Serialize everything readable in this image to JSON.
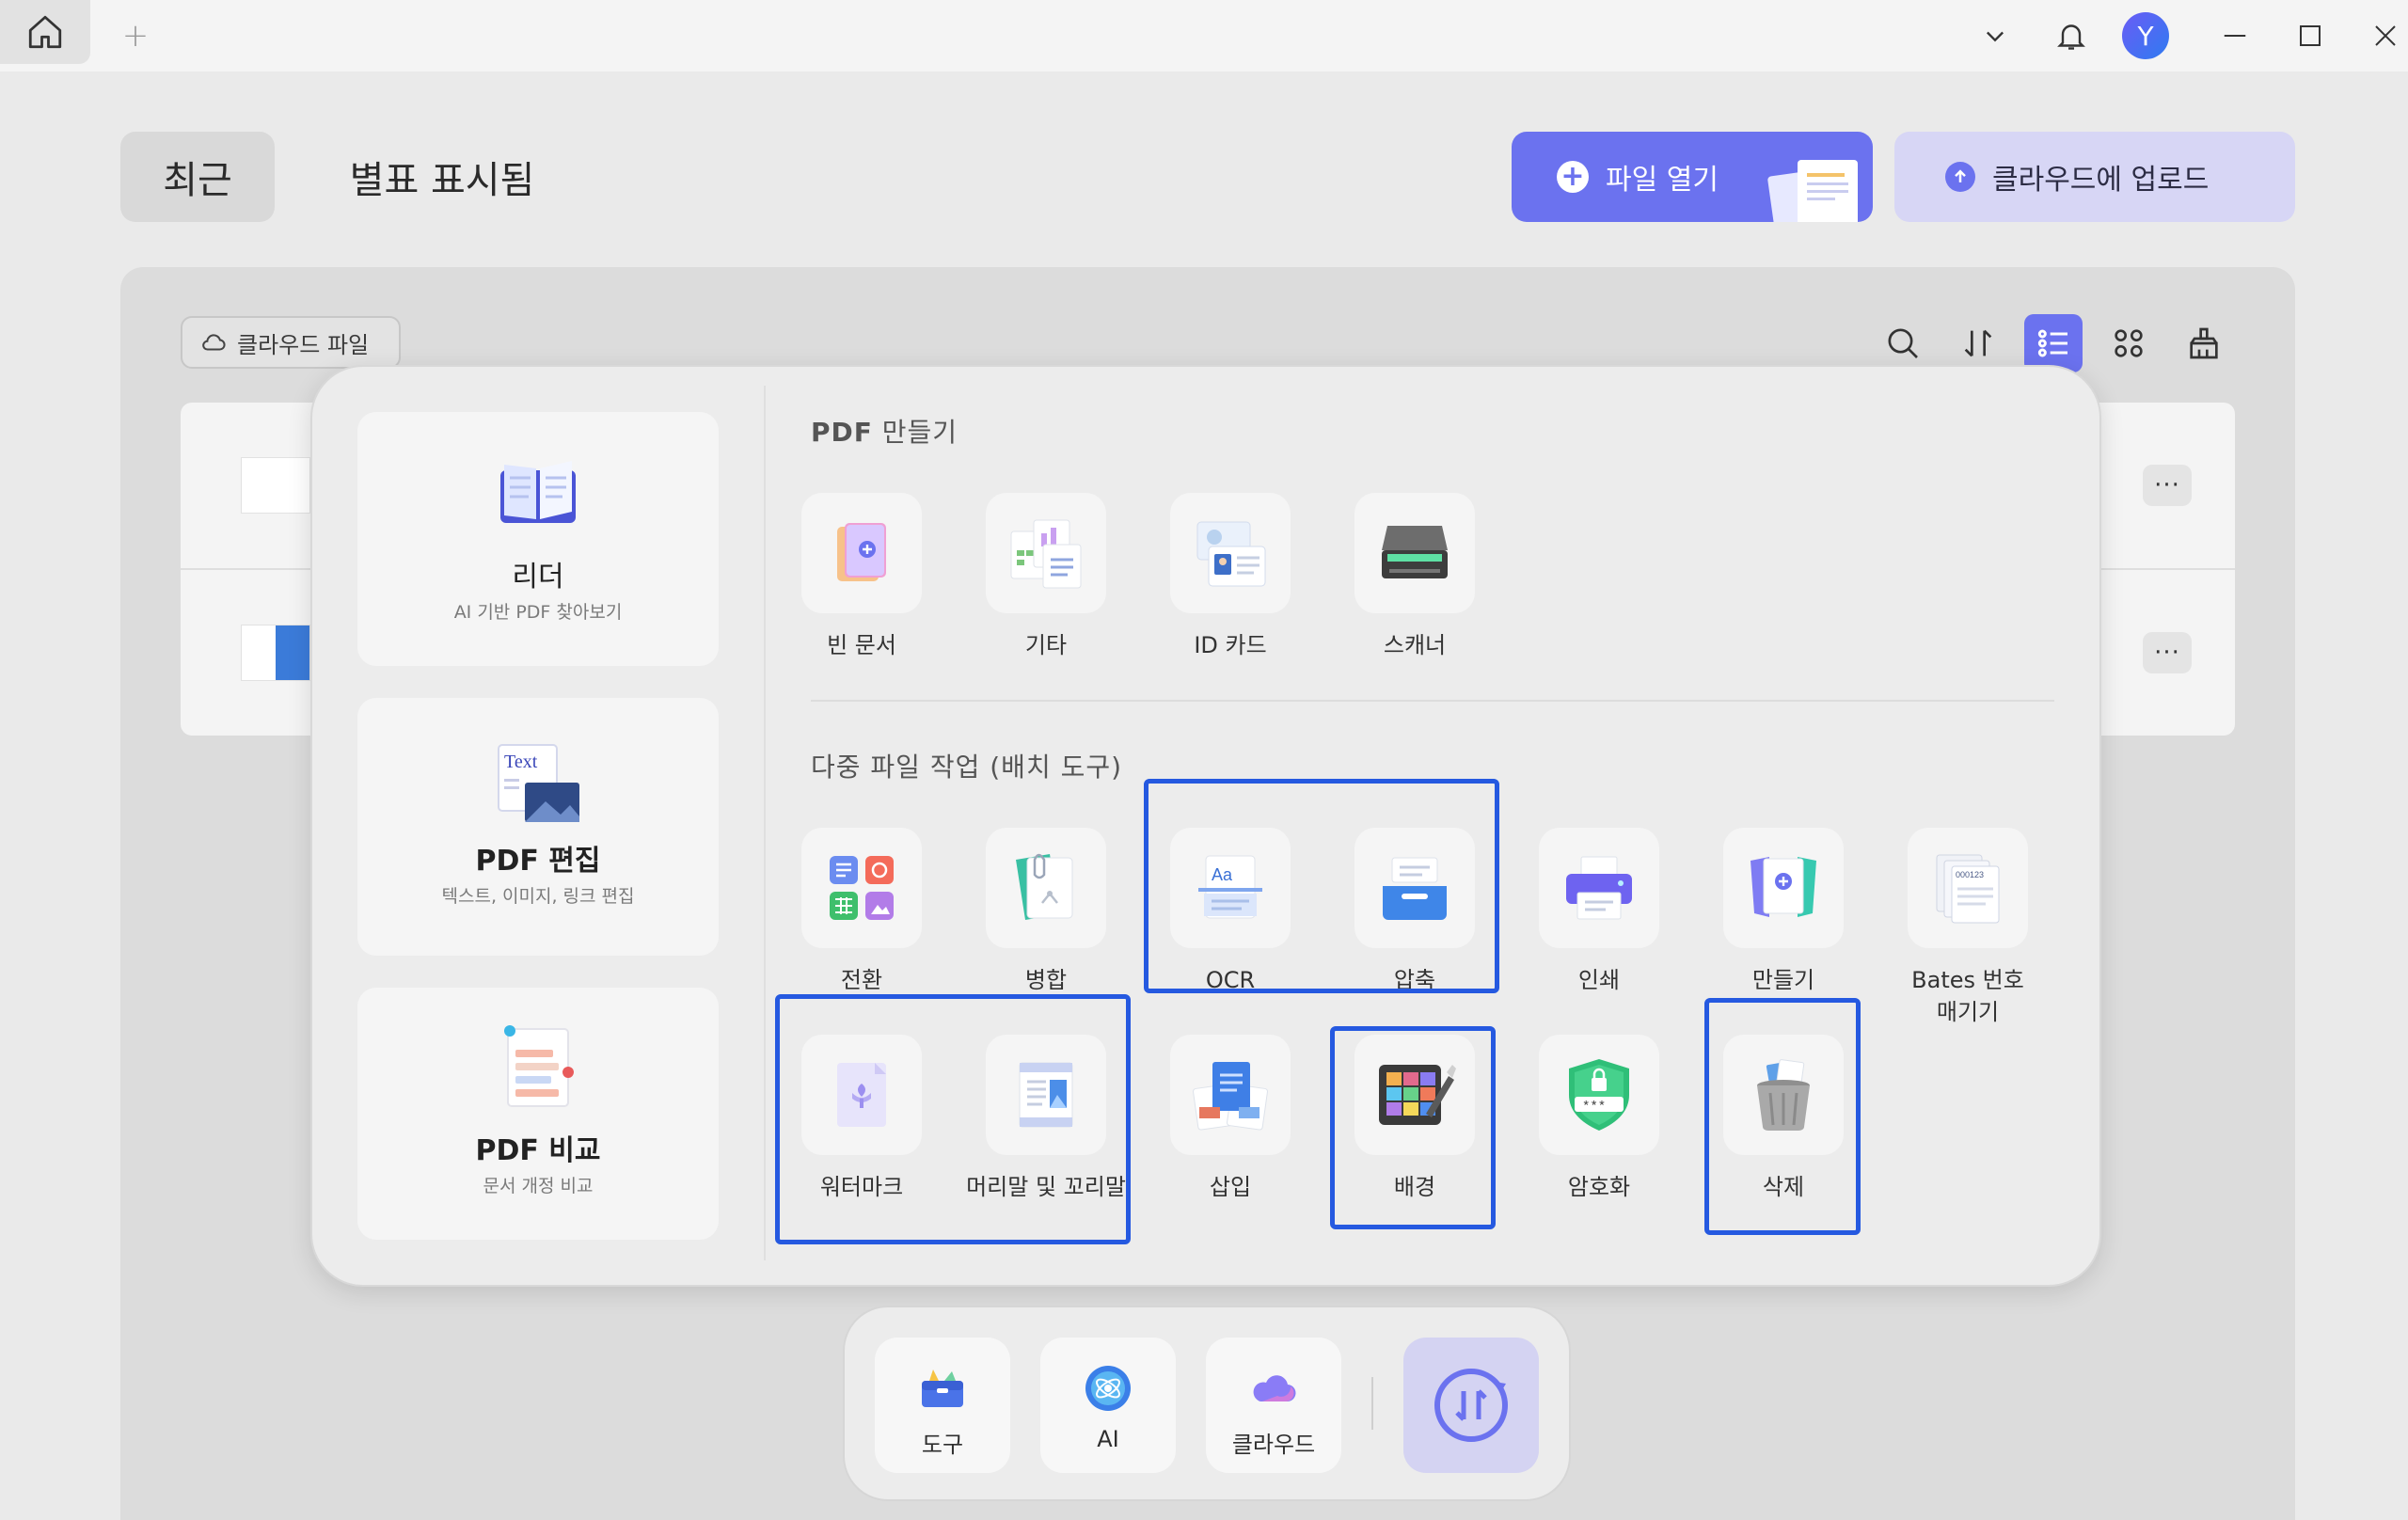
{
  "titlebar": {
    "new_tab_symbol": "+",
    "avatar_initial": "Y"
  },
  "header": {
    "tab_recent": "최근",
    "tab_starred": "별표 표시됨",
    "open_file_label": "파일 열기",
    "upload_label": "클라우드에 업로드",
    "accent_color": "#6b72ef"
  },
  "files": {
    "cloud_chip_label": "클라우드 파일",
    "more_label": "···"
  },
  "popup": {
    "modes": [
      {
        "title": "리더",
        "subtitle": "AI 기반 PDF 찾아보기",
        "icon": "book-icon"
      },
      {
        "title": "PDF 편집",
        "subtitle": "텍스트, 이미지, 링크 편집",
        "icon": "text-edit-icon",
        "icon_text": "Text"
      },
      {
        "title": "PDF 비교",
        "subtitle": "문서 개정 비교",
        "icon": "compare-icon"
      }
    ],
    "create_section_title_bold": "PDF",
    "create_section_title_rest": " 만들기",
    "create_tools": [
      {
        "label": "빈 문서",
        "icon": "blank-doc-icon"
      },
      {
        "label": "기타",
        "icon": "other-files-icon"
      },
      {
        "label": "ID 카드",
        "icon": "id-card-icon"
      },
      {
        "label": "스캐너",
        "icon": "scanner-icon"
      }
    ],
    "batch_section_title": "다중 파일 작업 (배치 도구)",
    "batch_tools": [
      {
        "label": "전환",
        "icon": "convert-icon"
      },
      {
        "label": "병합",
        "icon": "merge-icon"
      },
      {
        "label": "OCR",
        "icon": "ocr-icon",
        "icon_text": "Aa"
      },
      {
        "label": "압축",
        "icon": "compress-icon"
      },
      {
        "label": "인쇄",
        "icon": "print-icon"
      },
      {
        "label": "만들기",
        "icon": "create-icon"
      },
      {
        "label": "Bates 번호\n매기기",
        "icon": "bates-icon",
        "icon_text": "000123"
      },
      {
        "label": "워터마크",
        "icon": "watermark-icon"
      },
      {
        "label": "머리말 및 꼬리말",
        "icon": "header-footer-icon"
      },
      {
        "label": "삽입",
        "icon": "insert-icon"
      },
      {
        "label": "배경",
        "icon": "background-icon"
      },
      {
        "label": "암호화",
        "icon": "encrypt-icon",
        "icon_text": "***"
      },
      {
        "label": "삭제",
        "icon": "delete-icon"
      }
    ],
    "highlight_color": "#2559e0"
  },
  "dock": {
    "items": [
      {
        "label": "도구",
        "icon": "toolbox-icon"
      },
      {
        "label": "AI",
        "icon": "ai-icon"
      },
      {
        "label": "클라우드",
        "icon": "cloud-icon"
      }
    ],
    "active_icon": "batch-convert-icon"
  }
}
